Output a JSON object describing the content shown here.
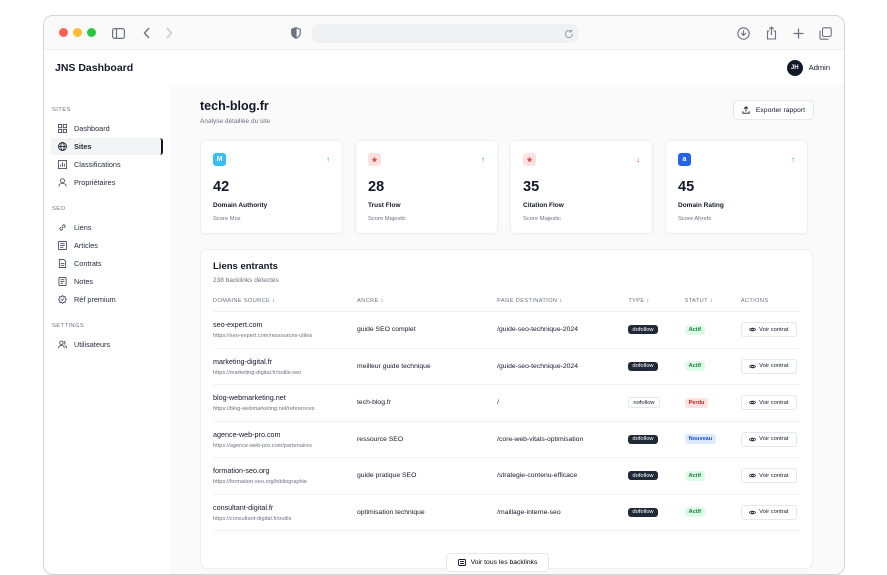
{
  "app": {
    "brand": "JNS Dashboard",
    "user_initials": "JH",
    "user_name": "Admin"
  },
  "sidebar": {
    "sections": [
      {
        "title": "SITES",
        "items": [
          {
            "label": "Dashboard",
            "icon": "grid-icon"
          },
          {
            "label": "Sites",
            "icon": "globe-icon",
            "active": true
          },
          {
            "label": "Classifications",
            "icon": "chart-icon"
          },
          {
            "label": "Propriétaires",
            "icon": "user-icon"
          }
        ]
      },
      {
        "title": "SEO",
        "items": [
          {
            "label": "Liens",
            "icon": "link-icon"
          },
          {
            "label": "Articles",
            "icon": "article-icon"
          },
          {
            "label": "Contrats",
            "icon": "document-icon"
          },
          {
            "label": "Notes",
            "icon": "note-icon"
          },
          {
            "label": "Réf premium",
            "icon": "badge-icon"
          }
        ]
      },
      {
        "title": "SETTINGS",
        "items": [
          {
            "label": "Utilisateurs",
            "icon": "users-icon"
          }
        ]
      }
    ]
  },
  "page": {
    "title": "tech-blog.fr",
    "subtitle": "Analyse détaillée du site",
    "export_label": "Exporter rapport"
  },
  "metrics": [
    {
      "icon_text": "M",
      "icon_color": "#38bdf8",
      "value": "42",
      "label": "Domain Authority",
      "source": "Score Moz",
      "trend": "up"
    },
    {
      "icon_text": "★",
      "icon_color": "#ef4444",
      "value": "28",
      "label": "Trust Flow",
      "source": "Score Majestic",
      "trend": "up"
    },
    {
      "icon_text": "★",
      "icon_color": "#ef4444",
      "value": "35",
      "label": "Citation Flow",
      "source": "Score Majestic",
      "trend": "down"
    },
    {
      "icon_text": "a",
      "icon_color": "#2563eb",
      "value": "45",
      "label": "Domain Rating",
      "source": "Score Ahrefs",
      "trend": "up"
    }
  ],
  "backlinks": {
    "title": "Liens entrants",
    "subtitle": "238 backlinks détectés",
    "columns": [
      "DOMAINE SOURCE",
      "ANCRE",
      "PAGE DESTINATION",
      "TYPE",
      "STATUT",
      "ACTIONS"
    ],
    "action_label": "Voir contrat",
    "view_all_label": "Voir tous les backlinks",
    "rows": [
      {
        "domain": "seo-expert.com",
        "url": "https://seo-expert.com/ressources-utiles",
        "anchor": "guide SEO complet",
        "dest": "/guide-seo-technique-2024",
        "type": "dofollow",
        "status": "Actif"
      },
      {
        "domain": "marketing-digital.fr",
        "url": "https://marketing-digital.fr/outils-seo",
        "anchor": "meilleur guide technique",
        "dest": "/guide-seo-technique-2024",
        "type": "dofollow",
        "status": "Actif"
      },
      {
        "domain": "blog-webmarketing.net",
        "url": "https://blog-webmarketing.net/references",
        "anchor": "tech-blog.fr",
        "dest": "/",
        "type": "nofollow",
        "status": "Perdu"
      },
      {
        "domain": "agence-web-pro.com",
        "url": "https://agence-web-pro.com/partenaires",
        "anchor": "ressource SEO",
        "dest": "/core-web-vitals-optimisation",
        "type": "dofollow",
        "status": "Nouveau"
      },
      {
        "domain": "formation-seo.org",
        "url": "https://formation-seo.org/bibliographie",
        "anchor": "guide pratique SEO",
        "dest": "/strategie-contenu-efficace",
        "type": "dofollow",
        "status": "Actif"
      },
      {
        "domain": "consultant-digital.fr",
        "url": "https://consultant-digital.fr/outils",
        "anchor": "optimisation technique",
        "dest": "/maillage-interne-seo",
        "type": "dofollow",
        "status": "Actif"
      }
    ]
  },
  "status_colors": {
    "Actif": [
      "#dcfce7",
      "#15803d"
    ],
    "Perdu": [
      "#fee2e2",
      "#b91c1c"
    ],
    "Nouveau": [
      "#dbeafe",
      "#1d4ed8"
    ]
  }
}
